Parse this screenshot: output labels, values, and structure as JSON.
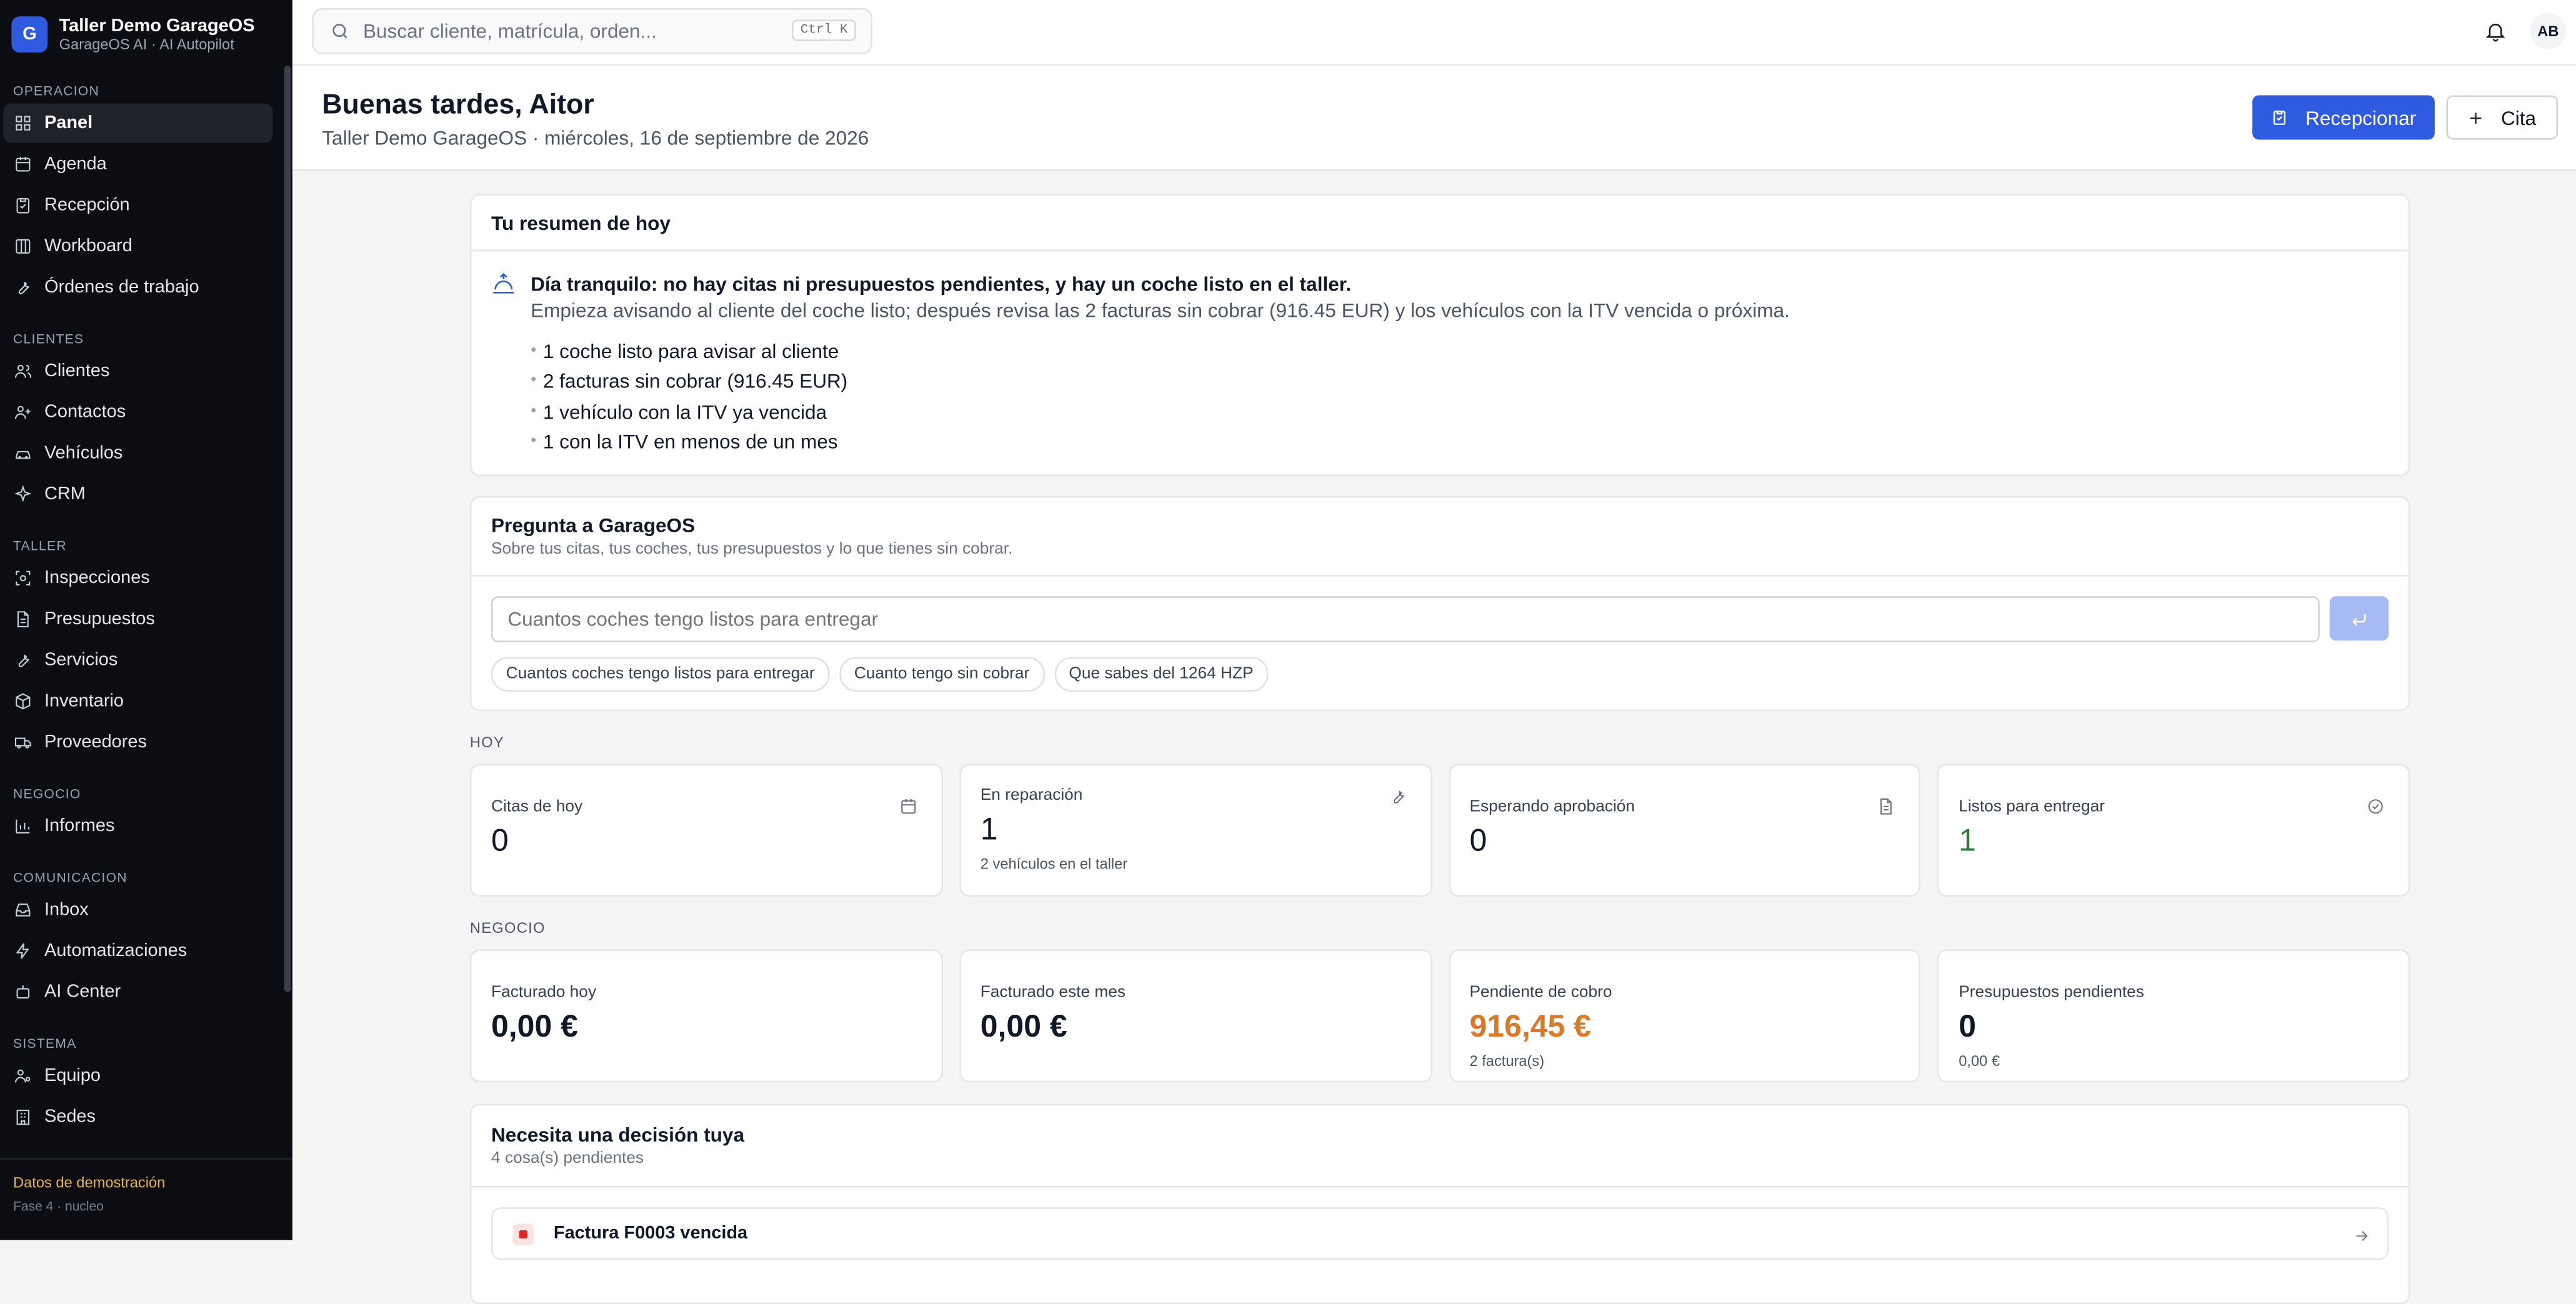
{
  "brand": {
    "logo_letter": "G",
    "title": "Taller Demo GarageOS",
    "subtitle": "GarageOS AI · AI Autopilot"
  },
  "sidebar": {
    "sections": [
      {
        "heading": "OPERACION",
        "items": [
          {
            "label": "Panel",
            "icon": "grid-icon",
            "active": true
          },
          {
            "label": "Agenda",
            "icon": "calendar-icon"
          },
          {
            "label": "Recepción",
            "icon": "clipboard-icon"
          },
          {
            "label": "Workboard",
            "icon": "columns-icon"
          },
          {
            "label": "Órdenes de trabajo",
            "icon": "wrench-icon"
          }
        ]
      },
      {
        "heading": "CLIENTES",
        "items": [
          {
            "label": "Clientes",
            "icon": "users-icon"
          },
          {
            "label": "Contactos",
            "icon": "user-plus-icon"
          },
          {
            "label": "Vehículos",
            "icon": "car-icon"
          },
          {
            "label": "CRM",
            "icon": "sparkles-icon"
          }
        ]
      },
      {
        "heading": "TALLER",
        "items": [
          {
            "label": "Inspecciones",
            "icon": "scan-icon"
          },
          {
            "label": "Presupuestos",
            "icon": "document-icon"
          },
          {
            "label": "Servicios",
            "icon": "wrench-icon"
          },
          {
            "label": "Inventario",
            "icon": "package-icon"
          },
          {
            "label": "Proveedores",
            "icon": "truck-icon"
          }
        ]
      },
      {
        "heading": "NEGOCIO",
        "items": [
          {
            "label": "Informes",
            "icon": "bar-chart-icon"
          }
        ]
      },
      {
        "heading": "COMUNICACION",
        "items": [
          {
            "label": "Inbox",
            "icon": "inbox-icon"
          },
          {
            "label": "Automatizaciones",
            "icon": "zap-icon"
          },
          {
            "label": "AI Center",
            "icon": "bot-icon"
          }
        ]
      },
      {
        "heading": "SISTEMA",
        "items": [
          {
            "label": "Equipo",
            "icon": "user-cog-icon"
          },
          {
            "label": "Sedes",
            "icon": "building-icon"
          }
        ]
      }
    ],
    "demo_title": "Datos de demostración",
    "demo_subtitle": "Fase 4 · nucleo"
  },
  "topbar": {
    "search_placeholder": "Buscar cliente, matrícula, orden...",
    "search_shortcut": "Ctrl K",
    "avatar_initials": "AB"
  },
  "header": {
    "greeting": "Buenas tardes, Aitor",
    "subline": "Taller Demo GarageOS · miércoles, 16 de septiembre de 2026",
    "primary_button": "Recepcionar",
    "secondary_button": "Cita"
  },
  "summary": {
    "title": "Tu resumen de hoy",
    "lead": "Día tranquilo: no hay citas ni presupuestos pendientes, y hay un coche listo en el taller.",
    "description": "Empieza avisando al cliente del coche listo; después revisa las 2 facturas sin cobrar (916.45 EUR) y los vehículos con la ITV vencida o próxima.",
    "items": [
      "1 coche listo para avisar al cliente",
      "2 facturas sin cobrar (916.45 EUR)",
      "1 vehículo con la ITV ya vencida",
      "1 con la ITV en menos de un mes"
    ]
  },
  "ask": {
    "title": "Pregunta a GarageOS",
    "subtitle": "Sobre tus citas, tus coches, tus presupuestos y lo que tienes sin cobrar.",
    "placeholder": "Cuantos coches tengo listos para entregar",
    "chips": [
      "Cuantos coches tengo listos para entregar",
      "Cuanto tengo sin cobrar",
      "Que sabes del 1264 HZP"
    ]
  },
  "today": {
    "label": "HOY",
    "cards": [
      {
        "label": "Citas de hoy",
        "value": "0",
        "note": "",
        "icon": "calendar-icon"
      },
      {
        "label": "En reparación",
        "value": "1",
        "note": "2 vehículos en el taller",
        "icon": "wrench-icon"
      },
      {
        "label": "Esperando aprobación",
        "value": "0",
        "note": "",
        "icon": "document-icon"
      },
      {
        "label": "Listos para entregar",
        "value": "1",
        "note": "",
        "icon": "check-circle-icon",
        "color": "#2e7d32"
      }
    ]
  },
  "business": {
    "label": "NEGOCIO",
    "cards": [
      {
        "label": "Facturado hoy",
        "value": "0,00 €",
        "note": ""
      },
      {
        "label": "Facturado este mes",
        "value": "0,00 €",
        "note": ""
      },
      {
        "label": "Pendiente de cobro",
        "value": "916,45 €",
        "note": "2 factura(s)",
        "color": "#d97a2b"
      },
      {
        "label": "Presupuestos pendientes",
        "value": "0",
        "note": "0,00 €"
      }
    ]
  },
  "decision": {
    "title": "Necesita una decisión tuya",
    "subtitle": "4 cosa(s) pendientes",
    "first_item": "Factura F0003 vencida"
  },
  "colors": {
    "accent": "#2f5be0",
    "sidebar_bg": "#0b0d12",
    "demo_title": "#e8b547"
  }
}
